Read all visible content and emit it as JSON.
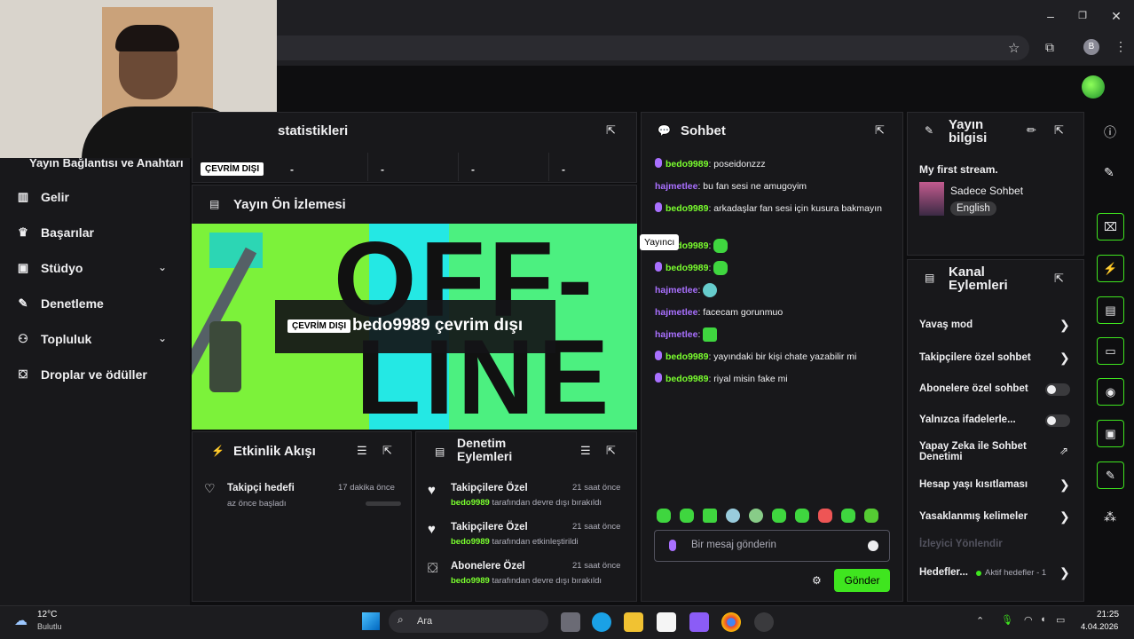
{
  "browser": {
    "window_min": "–",
    "window_max": "❐",
    "window_close": "✕",
    "star": "☆",
    "ext": "⧉",
    "profile": "B",
    "menu": "⋮"
  },
  "sidebar": {
    "header": "Yayın Bağlantısı ve Anahtarı",
    "items": [
      {
        "label": "Gelir",
        "icon": "bar-chart-icon"
      },
      {
        "label": "Başarılar",
        "icon": "trophy-icon"
      },
      {
        "label": "Stüdyo",
        "icon": "film-icon",
        "expandable": true
      },
      {
        "label": "Denetleme",
        "icon": "wrench-icon"
      },
      {
        "label": "Topluluk",
        "icon": "people-icon",
        "expandable": true
      },
      {
        "label": "Droplar ve ödüller",
        "icon": "gift-icon"
      }
    ]
  },
  "stats": {
    "title": "statistikleri",
    "status_badge": "ÇEVRİM DIŞI",
    "cells": [
      "-",
      "-",
      "-",
      "-"
    ]
  },
  "preview": {
    "title": "Yayın Ön İzlemesi",
    "badge": "ÇEVRİM DIŞI",
    "message": "bedo9989 çevrim dışı",
    "bg_text_top": "OFF-",
    "bg_text_bottom": "LINE"
  },
  "activity": {
    "title": "Etkinlik Akışı",
    "items": [
      {
        "title": "Takipçi hedefi",
        "sub": "az önce başladı",
        "time": "17 dakika önce"
      }
    ]
  },
  "mod_actions": {
    "title_line1": "Denetim",
    "title_line2": "Eylemleri",
    "items": [
      {
        "title": "Takipçilere Özel",
        "user": "bedo9989",
        "rest": " tarafından devre dışı bırakıldı",
        "time": "21 saat önce"
      },
      {
        "title": "Takipçilere Özel",
        "user": "bedo9989",
        "rest": " tarafından etkinleştirildi",
        "time": "21 saat önce"
      },
      {
        "title": "Abonelere Özel",
        "user": "bedo9989",
        "rest": " tarafından devre dışı bırakıldı",
        "time": "21 saat önce"
      }
    ]
  },
  "chat": {
    "title": "Sohbet",
    "tooltip": "Yayıncı",
    "messages": [
      {
        "user": "bedo9989",
        "text": ": poseidonzzz"
      },
      {
        "user": "hajmetlee",
        "text": ": bu fan sesi ne amugoyim"
      },
      {
        "user": "bedo9989",
        "text": ": arkadaşlar fan sesi için kusura bakmayın"
      },
      {
        "user": "bedo9989",
        "text": ": "
      },
      {
        "user": "bedo9989",
        "text": ": "
      },
      {
        "user": "hajmetlee",
        "text": ": "
      },
      {
        "user": "hajmetlee",
        "text": ": facecam gorunmuo"
      },
      {
        "user": "hajmetlee",
        "text": ": "
      },
      {
        "user": "bedo9989",
        "text": ": yayındaki bir kişi chate yazabilir mi"
      },
      {
        "user": "bedo9989",
        "text": ": riyal misin fake mi"
      }
    ],
    "input_placeholder": "Bir mesaj gönderin",
    "send_label": "Gönder"
  },
  "stream_info": {
    "title_line1": "Yayın",
    "title_line2": "bilgisi",
    "stream_title": "My first stream.",
    "category": "Sadece Sohbet",
    "language": "English"
  },
  "channel_actions": {
    "title_line1": "Kanal",
    "title_line2": "Eylemleri",
    "rows": [
      {
        "label": "Yavaş mod",
        "control": "arrow"
      },
      {
        "label": "Takipçilere özel sohbet",
        "control": "arrow"
      },
      {
        "label": "Abonelere özel sohbet",
        "control": "toggle"
      },
      {
        "label": "Yalnızca ifadelerle...",
        "control": "toggle"
      },
      {
        "label": "Yapay Zeka ile Sohbet Denetimi",
        "control": "external"
      },
      {
        "label": "Hesap yaşı kısıtlaması",
        "control": "arrow"
      },
      {
        "label": "Yasaklanmış kelimeler",
        "control": "arrow"
      },
      {
        "label": "İzleyici Yönlendir",
        "control": "none"
      },
      {
        "label": "Hedefler...",
        "control": "arrow",
        "extra": "Aktif hedefler - 1"
      }
    ]
  },
  "taskbar": {
    "temp": "12°C",
    "weather": "Bulutlu",
    "search": "Ara",
    "time": "21:25",
    "date": "4.04.2026"
  }
}
